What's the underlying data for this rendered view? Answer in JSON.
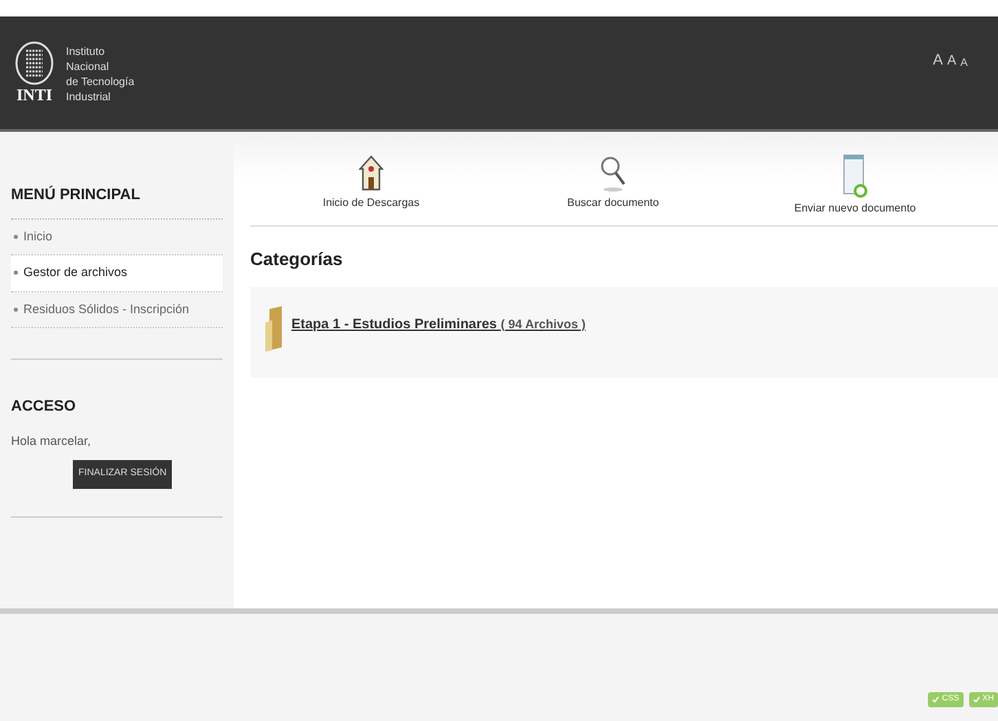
{
  "header": {
    "logo_lines": [
      "Instituto",
      "Nacional",
      "de Tecnología",
      "Industrial"
    ],
    "logo_mark": "INTI",
    "font_sizes": [
      "A",
      "A",
      "A"
    ]
  },
  "sidebar": {
    "menu_title": "MENÚ PRINCIPAL",
    "items": [
      {
        "label": "Inicio",
        "selected": false
      },
      {
        "label": "Gestor de archivos",
        "selected": true
      },
      {
        "label": "Residuos Sólidos - Inscripción",
        "selected": false
      }
    ],
    "access_title": "ACCESO",
    "greeting": "Hola marcelar,",
    "logout_button": "FINALIZAR SESIÓN"
  },
  "toolbar": [
    {
      "kind": "home",
      "label": "Inicio de Descargas"
    },
    {
      "kind": "search",
      "label": "Buscar documento"
    },
    {
      "kind": "upload",
      "label": "Enviar nuevo documento"
    }
  ],
  "categories": {
    "title": "Categorías",
    "items": [
      {
        "name": "Etapa 1 - Estudios Preliminares",
        "count": "( 94 Archivos )"
      }
    ]
  },
  "footer": {
    "badges": [
      "CSS",
      "XH"
    ]
  }
}
